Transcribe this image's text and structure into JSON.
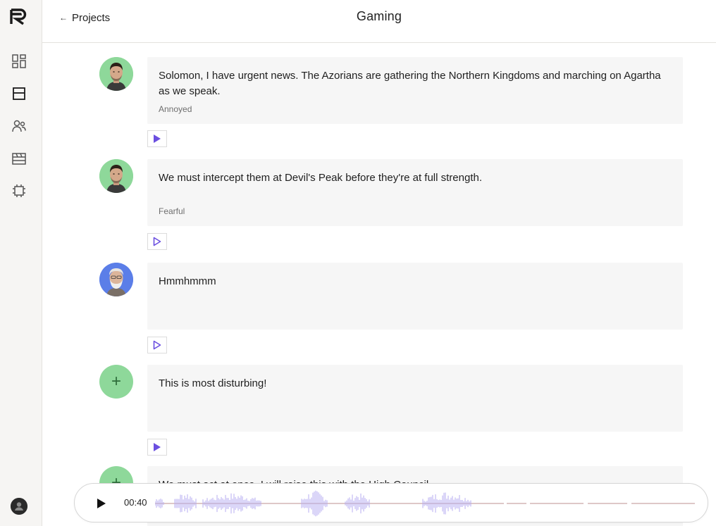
{
  "app": {
    "logo_letter": "R"
  },
  "sidebar": {
    "items": [
      {
        "name": "dashboard-icon"
      },
      {
        "name": "script-icon"
      },
      {
        "name": "voices-icon"
      },
      {
        "name": "scenes-icon"
      },
      {
        "name": "chip-icon"
      }
    ]
  },
  "header": {
    "back_label": "Projects",
    "title": "Gaming"
  },
  "lines": [
    {
      "text": "Solomon, I have urgent news. The Azorians are gathering the Northern Kingdoms and marching on Agartha as we speak.",
      "emotion": "Annoyed",
      "avatar": "young-man",
      "play_style": "filled"
    },
    {
      "text": "We must intercept them at Devil's Peak before they're at full strength.",
      "emotion": "Fearful",
      "avatar": "young-man",
      "play_style": "outline"
    },
    {
      "text": "Hmmhmmm",
      "emotion": "",
      "avatar": "old-man",
      "play_style": "outline"
    },
    {
      "text": "This is most disturbing!",
      "emotion": "",
      "avatar": "add",
      "play_style": "filled"
    },
    {
      "text": "We must act at once. I will raise this with the High Council.",
      "emotion": "",
      "avatar": "add",
      "play_style": "filled"
    }
  ],
  "player": {
    "time": "00:40"
  },
  "colors": {
    "accent": "#6b4fe0",
    "avatar_green": "#8ed89a",
    "avatar_blue": "#5b7ee8",
    "bubble_bg": "#f6f6f6",
    "wave": "#b7aef0",
    "wave_line": "#a66b6b"
  }
}
